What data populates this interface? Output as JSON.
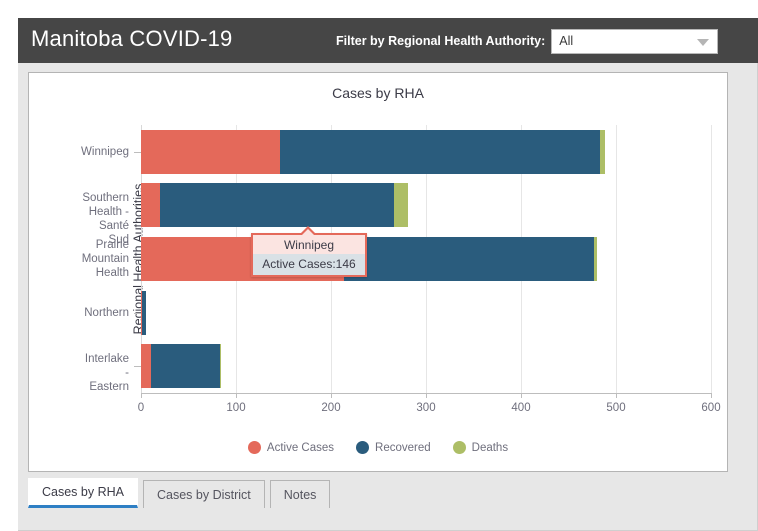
{
  "header": {
    "app_title": "Manitoba COVID-19",
    "filter_label": "Filter by Regional Health Authority:",
    "filter_value": "All",
    "chevron_icon": "chevron-down-icon",
    "bar_color": "#464646"
  },
  "card": {
    "chart_title": "Cases by RHA"
  },
  "tooltip": {
    "title": "Winnipeg",
    "detail": "Active Cases:146",
    "border_color": "#e4695a"
  },
  "tabs": [
    {
      "label": "Cases by RHA",
      "active": true
    },
    {
      "label": "Cases by District",
      "active": false
    },
    {
      "label": "Notes",
      "active": false
    }
  ],
  "chart_data": {
    "type": "bar",
    "orientation": "horizontal",
    "stacked": true,
    "title": "Cases by RHA",
    "xlabel": "",
    "ylabel": "Regional Health Authorities",
    "xlim": [
      0,
      600
    ],
    "xticks": [
      0,
      100,
      200,
      300,
      400,
      500,
      600
    ],
    "grid": true,
    "legend_position": "bottom",
    "categories": [
      "Winnipeg",
      "Southern Health -\nSanté Sud",
      "Prairie\nMountain\nHealth",
      "Northern",
      "Interlake -\nEastern"
    ],
    "series": [
      {
        "name": "Active Cases",
        "color": "#e4695a",
        "values": [
          146,
          20,
          214,
          1,
          11
        ]
      },
      {
        "name": "Recovered",
        "color": "#2a5c7d",
        "values": [
          337,
          246,
          263,
          4,
          72
        ]
      },
      {
        "name": "Deaths",
        "color": "#adbe66",
        "values": [
          5,
          15,
          3,
          0,
          1
        ]
      }
    ],
    "totals": [
      488,
      281,
      480,
      5,
      84
    ]
  }
}
